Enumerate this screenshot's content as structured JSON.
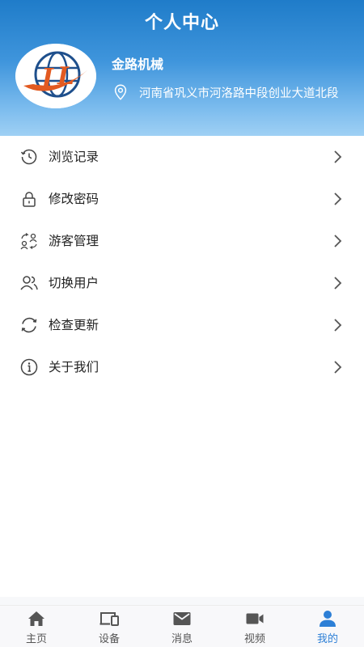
{
  "header": {
    "title": "个人中心",
    "company_name": "金路机械",
    "address": "河南省巩义市河洛路中段创业大道北段",
    "accent_color": "#2d7fd6"
  },
  "menu": {
    "items": [
      {
        "label": "浏览记录",
        "icon": "history-clock-icon"
      },
      {
        "label": "修改密码",
        "icon": "lock-icon"
      },
      {
        "label": "游客管理",
        "icon": "visitor-manage-icon"
      },
      {
        "label": "切换用户",
        "icon": "switch-user-icon"
      },
      {
        "label": "检查更新",
        "icon": "refresh-icon"
      },
      {
        "label": "关于我们",
        "icon": "info-icon"
      }
    ]
  },
  "tabbar": {
    "tabs": [
      {
        "label": "主页",
        "icon": "home-icon",
        "active": false
      },
      {
        "label": "设备",
        "icon": "devices-icon",
        "active": false
      },
      {
        "label": "消息",
        "icon": "mail-icon",
        "active": false
      },
      {
        "label": "视频",
        "icon": "video-camera-icon",
        "active": false
      },
      {
        "label": "我的",
        "icon": "person-icon",
        "active": true
      }
    ]
  }
}
